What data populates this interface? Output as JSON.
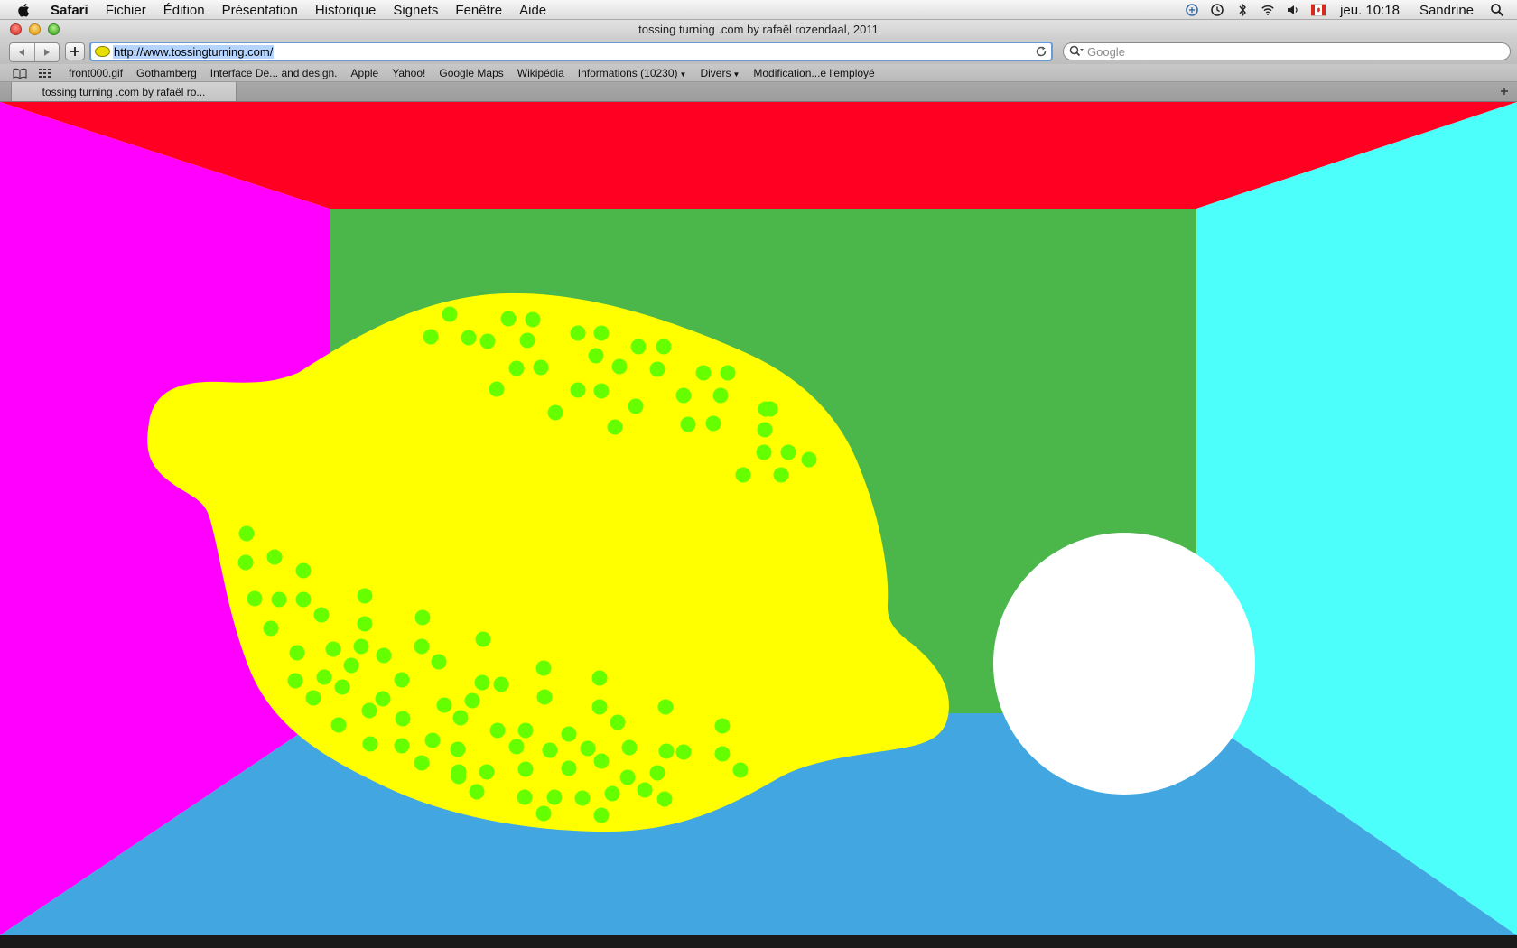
{
  "menubar": {
    "app_name": "Safari",
    "menus": [
      "Fichier",
      "Édition",
      "Présentation",
      "Historique",
      "Signets",
      "Fenêtre",
      "Aide"
    ],
    "clock": "jeu. 10:18",
    "user": "Sandrine",
    "status_icons": [
      "sync-icon",
      "time-machine-icon",
      "bluetooth-icon",
      "wifi-icon",
      "volume-icon",
      "flag-icon"
    ]
  },
  "window": {
    "title": "tossing turning .com by rafaël rozendaal, 2011"
  },
  "toolbar": {
    "url": "http://www.tossingturning.com/",
    "search_placeholder": "Google"
  },
  "bookmarks": {
    "items": [
      {
        "label": "front000.gif"
      },
      {
        "label": "Gothamberg"
      },
      {
        "label": "Interface De... and design."
      },
      {
        "label": "Apple"
      },
      {
        "label": "Yahoo!"
      },
      {
        "label": "Google Maps"
      },
      {
        "label": "Wikipédia"
      },
      {
        "label": "Informations (10230)",
        "has_menu": true
      },
      {
        "label": "Divers",
        "has_menu": true
      },
      {
        "label": "Modification...e l'employé"
      }
    ]
  },
  "tabs": [
    {
      "label": "tossing turning .com by rafaël ro..."
    }
  ],
  "scene": {
    "colors": {
      "ceiling": "#ff0022",
      "left_wall": "#ff00ff",
      "right_wall": "#4dfffb",
      "back_wall": "#4bb74b",
      "floor": "#42a6e0",
      "lemon": "#ffff00",
      "lemon_dots": "#66ff00",
      "ball": "#ffffff"
    }
  }
}
